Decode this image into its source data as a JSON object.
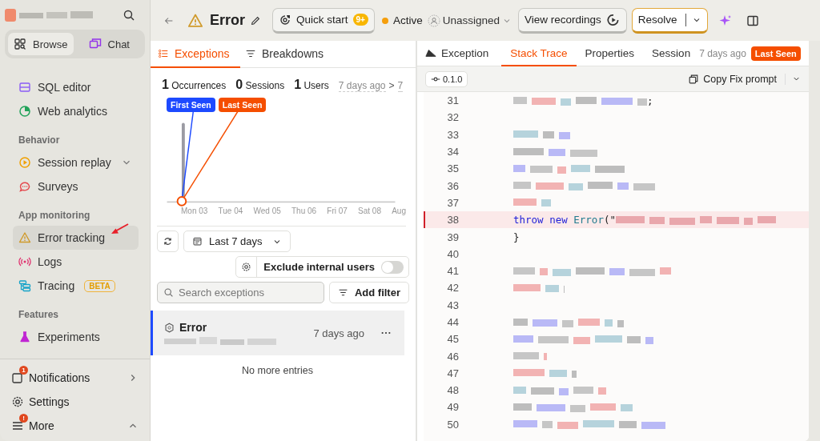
{
  "sidebar": {
    "modes": [
      {
        "label": "Browse",
        "kind": "browse",
        "selected": true
      },
      {
        "label": "Chat",
        "kind": "chat",
        "selected": false
      }
    ],
    "sections": [
      {
        "items": [
          {
            "label": "SQL editor",
            "kind": "sql",
            "selected": false
          },
          {
            "label": "Web analytics",
            "kind": "web",
            "selected": false
          }
        ]
      },
      {
        "title": "Behavior",
        "items": [
          {
            "label": "Session replay",
            "kind": "replay",
            "selected": false,
            "expandable": true
          },
          {
            "label": "Surveys",
            "kind": "survey",
            "selected": false
          }
        ]
      },
      {
        "title": "App monitoring",
        "items": [
          {
            "label": "Error tracking",
            "kind": "warning",
            "selected": true
          },
          {
            "label": "Logs",
            "kind": "logs",
            "selected": false
          },
          {
            "label": "Tracing",
            "kind": "tracing",
            "selected": false,
            "badge": "BETA"
          }
        ]
      },
      {
        "title": "Features",
        "items": [
          {
            "label": "Experiments",
            "kind": "flask",
            "selected": false
          }
        ]
      }
    ],
    "footer": [
      {
        "label": "Notifications",
        "kind": "bell",
        "badge": "1",
        "opens_submenu": true
      },
      {
        "label": "Settings",
        "kind": "gear"
      },
      {
        "label": "More",
        "kind": "menu",
        "badge": "!",
        "expandable": true
      }
    ]
  },
  "header": {
    "title": "Error",
    "quick_start": {
      "label": "Quick start",
      "badge": "9+"
    },
    "status": {
      "label": "Active",
      "color": "#f59e0b"
    },
    "assignee": "Unassigned",
    "recordings": "View recordings",
    "resolve": "Resolve"
  },
  "exceptions_pane": {
    "tabs": [
      {
        "label": "Exceptions",
        "kind": "list",
        "selected": true
      },
      {
        "label": "Breakdowns",
        "kind": "filter",
        "selected": false
      }
    ],
    "stats": [
      "**1** Occurrences",
      "**0** Sessions",
      "**1** Users"
    ],
    "range_start": "7 days ago",
    "range_sep": ">",
    "range_end": "7",
    "markers": [
      {
        "label": "First Seen",
        "color": "#1d4aff"
      },
      {
        "label": "Last Seen",
        "color": "#f54e00"
      }
    ],
    "axis_labels": [
      "Mon 03",
      "Tue 04",
      "Wed 05",
      "Thu 06",
      "Fri 07",
      "Sat 08",
      "Aug"
    ],
    "date_range": "Last 7 days",
    "exclude_internal": {
      "label": "Exclude internal users",
      "on": false
    },
    "search": {
      "placeholder": "Search exceptions"
    },
    "add_filter": "Add filter",
    "issues": [
      {
        "title": "Error",
        "time": "7 days ago",
        "selected": true
      }
    ],
    "end_note": "No more entries"
  },
  "trace_pane": {
    "tabs": [
      {
        "label": "Exception",
        "kind": "header",
        "selected": false
      },
      {
        "label": "Stack Trace",
        "kind": "tab",
        "selected": true
      },
      {
        "label": "Properties",
        "kind": "tab",
        "selected": false
      },
      {
        "label": "Session",
        "kind": "tab",
        "selected": false
      }
    ],
    "seen_time": "7 days ago",
    "seen_badge": "Last Seen",
    "version": "0.1.0",
    "copy_prompt": "Copy Fix prompt",
    "lines": [
      {
        "number": "31",
        "redacted": true,
        "highlighted": false,
        "tokens": [
          {
            "text": ";",
            "kind": "plain"
          }
        ]
      },
      {
        "number": "32",
        "redacted": false,
        "highlighted": false
      },
      {
        "number": "33",
        "redacted": true,
        "highlighted": false
      },
      {
        "number": "34",
        "redacted": true,
        "highlighted": false
      },
      {
        "number": "35",
        "redacted": true,
        "highlighted": false
      },
      {
        "number": "36",
        "redacted": true,
        "highlighted": false
      },
      {
        "number": "37",
        "redacted": true,
        "highlighted": false
      },
      {
        "number": "38",
        "redacted": true,
        "highlighted": true,
        "tokens": [
          {
            "text": "  throw",
            "kind": "keyword"
          },
          {
            "text": " new",
            "kind": "keyword"
          },
          {
            "text": " Error",
            "kind": "type"
          },
          {
            "text": "(\"",
            "kind": "plain"
          }
        ]
      },
      {
        "number": "39",
        "redacted": false,
        "highlighted": false,
        "tokens": [
          {
            "text": "}",
            "kind": "plain"
          }
        ]
      },
      {
        "number": "40",
        "redacted": false,
        "highlighted": false
      },
      {
        "number": "41",
        "redacted": true,
        "highlighted": false
      },
      {
        "number": "42",
        "redacted": true,
        "highlighted": false
      },
      {
        "number": "43",
        "redacted": false,
        "highlighted": false
      },
      {
        "number": "44",
        "redacted": true,
        "highlighted": false
      },
      {
        "number": "45",
        "redacted": true,
        "highlighted": false
      },
      {
        "number": "46",
        "redacted": true,
        "highlighted": false
      },
      {
        "number": "47",
        "redacted": true,
        "highlighted": false
      },
      {
        "number": "48",
        "redacted": true,
        "highlighted": false
      },
      {
        "number": "49",
        "redacted": true,
        "highlighted": false
      },
      {
        "number": "50",
        "redacted": true,
        "highlighted": false
      }
    ]
  }
}
